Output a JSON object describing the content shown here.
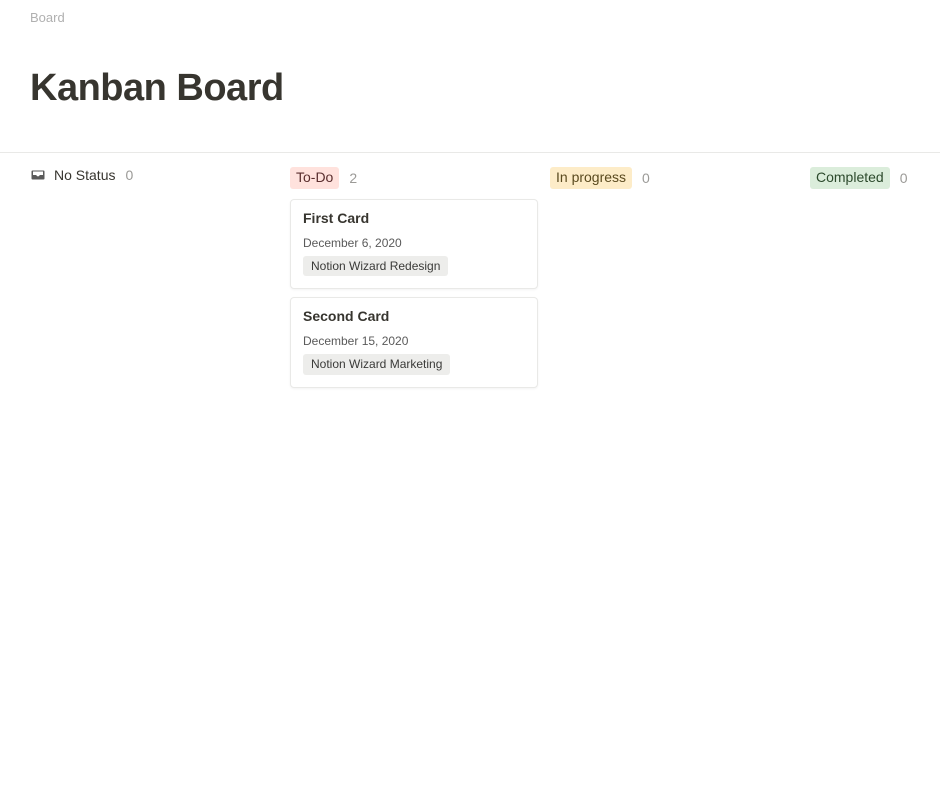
{
  "breadcrumb": "Board",
  "page_title": "Kanban Board",
  "columns": [
    {
      "id": "no-status",
      "label": "No Status",
      "count": 0,
      "style": "plain",
      "has_icon": true,
      "cards": []
    },
    {
      "id": "to-do",
      "label": "To-Do",
      "count": 2,
      "style": "red",
      "has_icon": false,
      "cards": [
        {
          "title": "First Card",
          "date": "December 6, 2020",
          "tag": "Notion Wizard Redesign"
        },
        {
          "title": "Second Card",
          "date": "December 15, 2020",
          "tag": "Notion Wizard Marketing"
        }
      ]
    },
    {
      "id": "in-progress",
      "label": "In progress",
      "count": 0,
      "style": "yellow",
      "has_icon": false,
      "cards": []
    },
    {
      "id": "completed",
      "label": "Completed",
      "count": 0,
      "style": "green",
      "has_icon": false,
      "cards": []
    }
  ]
}
